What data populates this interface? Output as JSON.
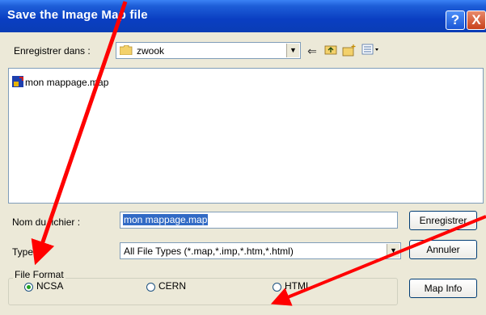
{
  "window": {
    "title": "Save the Image Map file",
    "help_label": "?",
    "close_label": "X"
  },
  "lookin": {
    "label": "Enregistrer dans :",
    "value": "zwook"
  },
  "files": [
    {
      "name": "mon mappage.map"
    }
  ],
  "filename": {
    "label": "Nom du fichier :",
    "value": "mon mappage.map"
  },
  "filetype": {
    "label": "Type :",
    "value": "All File Types (*.map,*.imp,*.htm,*.html)"
  },
  "buttons": {
    "save": "Enregistrer",
    "cancel": "Annuler",
    "map_info": "Map Info"
  },
  "format": {
    "legend": "File Format",
    "options": [
      {
        "label": "NCSA",
        "selected": true
      },
      {
        "label": "CERN",
        "selected": false
      },
      {
        "label": "HTML",
        "selected": false
      }
    ]
  },
  "colors": {
    "titlebar": "#0A3DB5",
    "selection": "#316AC5",
    "annotation_arrows": "#FF0000"
  }
}
